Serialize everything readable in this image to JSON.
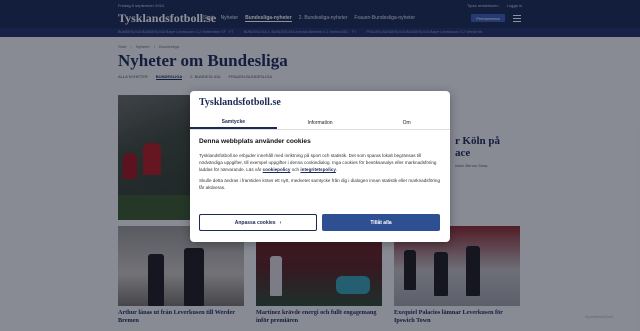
{
  "topbar": {
    "date": "Fredag 6 september 2024",
    "links": [
      "Tipsa redaktionen",
      "Logga in"
    ],
    "logo": "Tysklandsfotboll.se",
    "nav": [
      "Start",
      "Nyheter",
      "Bundesliga-nyheter",
      "2. Bundesliga-nyheter",
      "Frauen-Bundesliga-nyheter"
    ],
    "active_nav_index": 2,
    "premium_label": "Prenumerera"
  },
  "ticker": [
    "BUNDESLIGA BUNDESLIGA  Bayer Leverkusen 3-2 Hoffenheim SF · FT",
    "BUNDESLIGA 2. BUNDESLIGA  Arminia Bielefeld 0-1 Hertha BSC · FT",
    "FRAUEN-BUNDESLIGA BUNDESLIGA  Bayer Leverkusen 3-2 Werder Br"
  ],
  "breadcrumb": [
    "Start",
    "Nyheter",
    "Bundesliga"
  ],
  "page_title": "Nyheter om Bundesliga",
  "subtabs": [
    "ALLA NYHETER",
    "BUNDESLIGA",
    "2. BUNDESLIGA",
    "FRAUEN-BUNDESLIGA"
  ],
  "hero": {
    "title": "r Köln på\nace",
    "sub": "icken Benno Sosa."
  },
  "cards": [
    {
      "title": "Arthur lånas ut från Leverkusen till Werder Bremen"
    },
    {
      "title": "Martínez krävde energi och fullt engagemang inför premiären"
    },
    {
      "title": "Exequiel Palacios lämnar Leverkusen för Ipswich Town"
    }
  ],
  "modal": {
    "logo": "Tysklandsfotboll.se",
    "tabs": [
      "Samtycke",
      "Information",
      "Om"
    ],
    "heading": "Denna webbplats använder cookies",
    "body1": "Tysklandsfotboll.se erbjuder innehåll med inriktning på sport och statistik. Det som sparas lokalt begränsas till nödvändiga uppgifter, till exempel uppgifter i denna cookiedialog. Inga cookies för besöksanalys eller marknadsföring laddas för närvarande. Läs vår",
    "link1": "cookiepolicy",
    "and": "och",
    "link2": "integritetspolicy",
    "body2": "Skulle detta ändras i framtiden krävs ett nytt, medvetet samtycke från dig i dialogen innan statistik eller marknadsföring får aktiveras.",
    "customize_label": "Anpassa cookies",
    "allow_label": "Tillåt alla"
  },
  "watermark": "SportMediaCert",
  "colors": {
    "brand": "#1b2a55",
    "accent": "#2f4f93"
  }
}
